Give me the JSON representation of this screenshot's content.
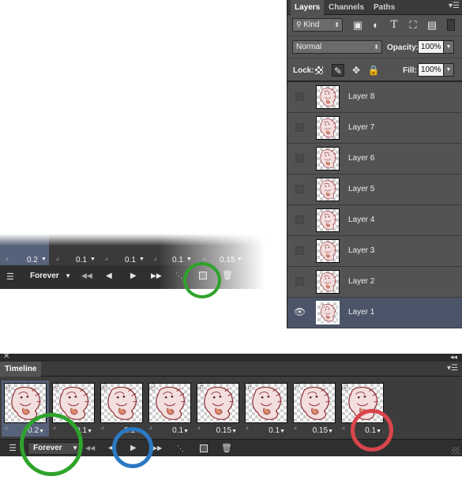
{
  "layers_panel": {
    "tabs": [
      "Layers",
      "Channels",
      "Paths"
    ],
    "active_tab": "Layers",
    "filter_kind": "Kind",
    "blend_mode": "Normal",
    "opacity_label": "Opacity:",
    "opacity_value": "100%",
    "lock_label": "Lock:",
    "fill_label": "Fill:",
    "fill_value": "100%",
    "layers": [
      {
        "name": "Layer 8",
        "visible": false,
        "selected": false
      },
      {
        "name": "Layer 7",
        "visible": false,
        "selected": false
      },
      {
        "name": "Layer 6",
        "visible": false,
        "selected": false
      },
      {
        "name": "Layer 5",
        "visible": false,
        "selected": false
      },
      {
        "name": "Layer 4",
        "visible": false,
        "selected": false
      },
      {
        "name": "Layer 3",
        "visible": false,
        "selected": false
      },
      {
        "name": "Layer 2",
        "visible": false,
        "selected": false
      },
      {
        "name": "Layer 1",
        "visible": true,
        "selected": true
      }
    ]
  },
  "cropped_timeline": {
    "delays": [
      "0.2",
      "0.1",
      "0.1",
      "0.1",
      "0.15"
    ],
    "loop": "Forever"
  },
  "timeline_panel": {
    "title": "Timeline",
    "frames": [
      {
        "number": "1",
        "delay": "0.2",
        "selected": true
      },
      {
        "number": "2",
        "delay": "0.1",
        "selected": false
      },
      {
        "number": "3",
        "delay": "0.1",
        "selected": false
      },
      {
        "number": "4",
        "delay": "0.1",
        "selected": false
      },
      {
        "number": "5",
        "delay": "0.15",
        "selected": false
      },
      {
        "number": "6",
        "delay": "0.1",
        "selected": false
      },
      {
        "number": "7",
        "delay": "0.15",
        "selected": false
      },
      {
        "number": "8",
        "delay": "0.1",
        "selected": false
      }
    ],
    "loop": "Forever",
    "controls": {
      "first": "◀◀",
      "prev": "◀",
      "play": "▶",
      "next": "▶▶"
    }
  },
  "annotations": {
    "green": "#2fa32c",
    "blue": "#2b78c2",
    "red": "#d9454c"
  },
  "icons": {
    "search": "search-icon",
    "eye": "eye-icon",
    "trash": "trash-icon",
    "new_frame": "new-frame-icon",
    "tween": "tween-icon",
    "convert": "convert-timeline-icon"
  }
}
